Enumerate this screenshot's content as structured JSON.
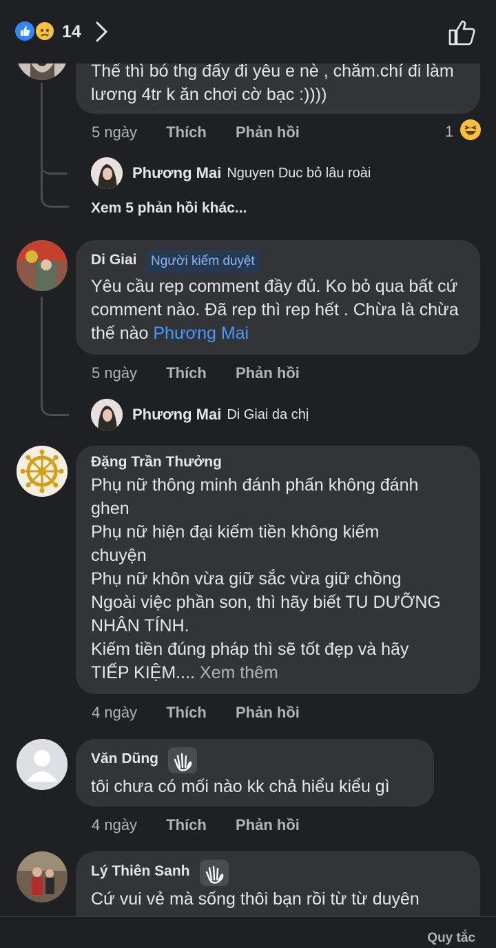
{
  "header": {
    "reaction_count": "14",
    "icons": [
      "like-reaction-icon",
      "sad-reaction-icon",
      "chevron-right-icon",
      "thumbs-up-icon"
    ]
  },
  "comments": [
    {
      "text": "Thế thì bó thg đấy đi yêu e nè , chăm.chí đi làm lương 4tr k ăn chơi cờ bạc :))))",
      "time": "5 ngày",
      "like": "Thích",
      "reply": "Phản hồi",
      "reaction_count": "1"
    },
    {
      "name": "Di Giai",
      "badge": "Người kiểm duyệt",
      "text": "Yêu cầu rep comment đầy đủ. Ko bỏ qua bất cứ comment nào. Đã rep thì rep hết . Chừa là chừa thế nào ",
      "mention": "Phương Mai",
      "time": "5 ngày",
      "like": "Thích",
      "reply": "Phản hồi"
    },
    {
      "name": "Đặng Trần Thưởng",
      "lines": [
        "Phụ nữ thông minh đánh phấn không đánh",
        "ghen",
        "Phụ nữ hiện đại kiếm tiền không kiếm",
        "chuyện",
        "Phụ nữ khôn vừa giữ sắc vừa giữ chồng",
        "Ngoài việc phần son, thì hãy biết TU DƯỠNG",
        "NHÂN TÍNH.",
        "Kiếm tiền đúng pháp thì sẽ tốt đẹp và hãy"
      ],
      "last_line": "TIẾP KIỆM.... ",
      "see_more": "Xem thêm",
      "time": "4 ngày",
      "like": "Thích",
      "reply": "Phản hồi"
    },
    {
      "name": "Văn Dũng",
      "text": "tôi chưa có mối nào kk chả hiểu kiểu gì",
      "time": "4 ngày",
      "like": "Thích",
      "reply": "Phản hồi"
    },
    {
      "name": "Lý Thiên Sanh",
      "text": "Cứ vui vẻ mà sống thôi bạn rồi từ từ duyên"
    }
  ],
  "replies": [
    {
      "name": "Phương Mai",
      "text": "Nguyen Duc bỏ lâu roài"
    },
    {
      "name": "Phương Mai",
      "text": "Di Giai  da chị"
    }
  ],
  "more_replies": "Xem 5 phản hồi khác...",
  "footer": {
    "rules": "Quy tắc"
  }
}
